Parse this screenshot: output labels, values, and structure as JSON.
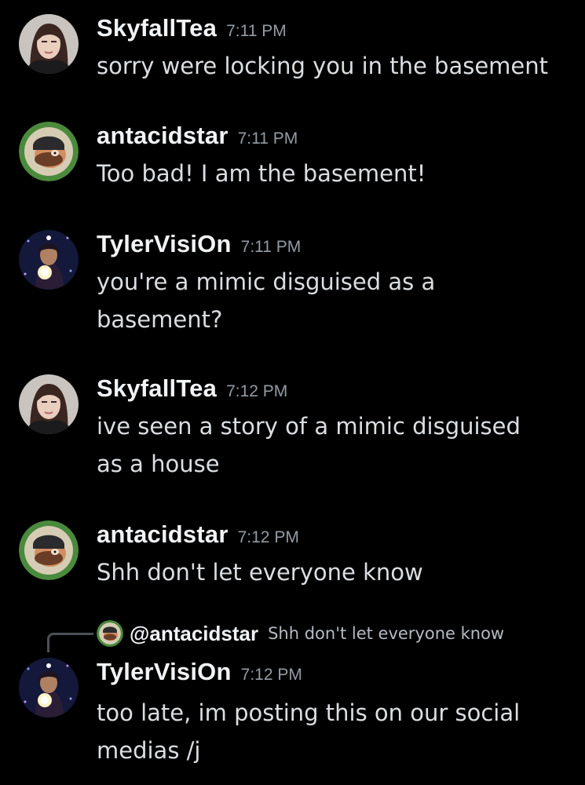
{
  "messages": [
    {
      "username": "SkyfallTea",
      "time": "7:11 PM",
      "text": "sorry were locking you in the basement",
      "avatar": "skyfalltea-avatar"
    },
    {
      "username": "antacidstar",
      "time": "7:11 PM",
      "text": "Too bad! I am the basement!",
      "avatar": "antacidstar-avatar"
    },
    {
      "username": "TylerVisiOn",
      "time": "7:11 PM",
      "text": "you're a mimic disguised as a basement?",
      "avatar": "tylervision-avatar"
    },
    {
      "username": "SkyfallTea",
      "time": "7:12 PM",
      "text": "ive seen a story of a mimic disguised as a house",
      "avatar": "skyfalltea-avatar"
    },
    {
      "username": "antacidstar",
      "time": "7:12 PM",
      "text": "Shh don't let everyone know",
      "avatar": "antacidstar-avatar"
    },
    {
      "username": "TylerVisiOn",
      "time": "7:12 PM",
      "text": "too late, im posting this on our social medias /j",
      "avatar": "tylervision-avatar"
    }
  ],
  "reply": {
    "mention": "@antacidstar",
    "text": "Shh don't let everyone know"
  },
  "colors": {
    "background": "#000000",
    "username": "#f2f3f5",
    "timestamp": "#949ba4",
    "message_text": "#dbdee1"
  }
}
